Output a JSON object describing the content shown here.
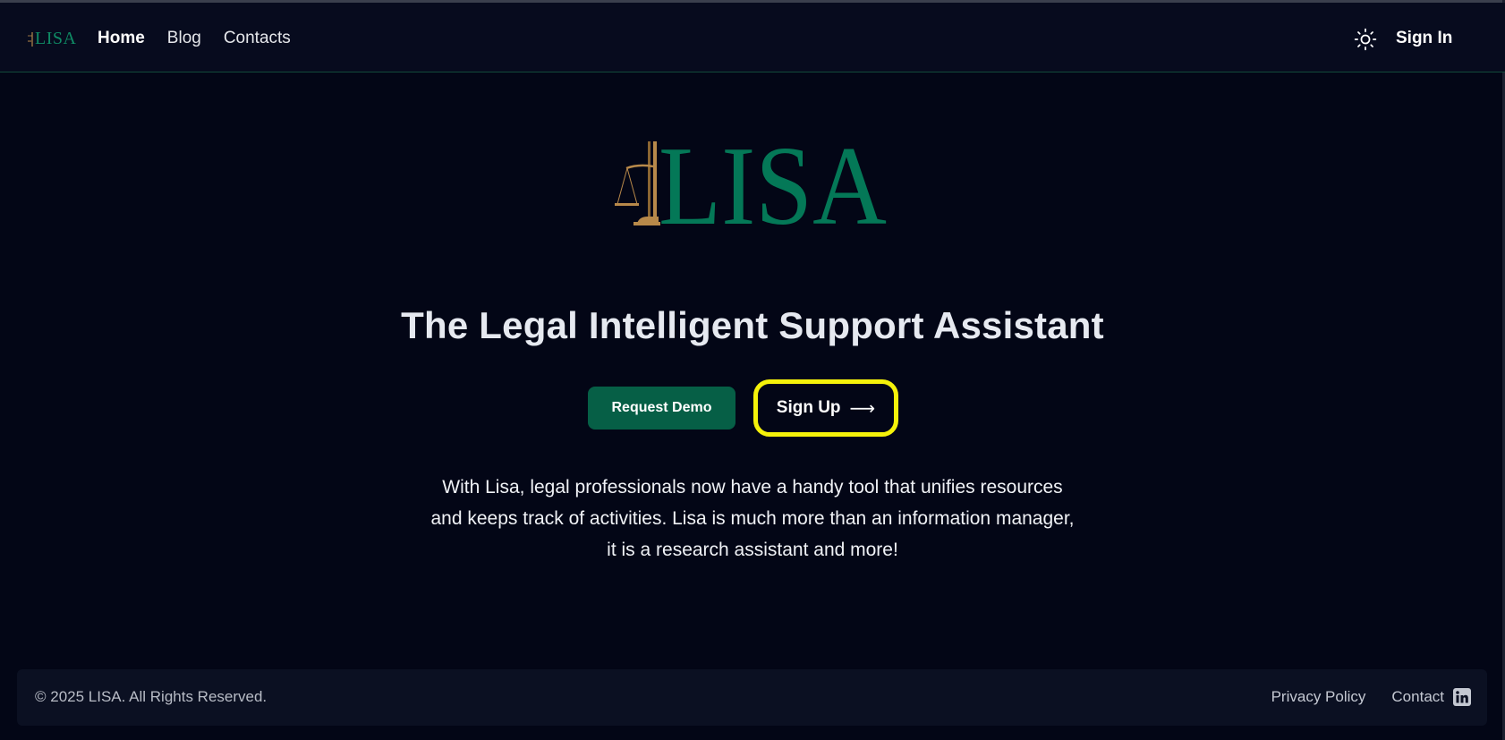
{
  "header": {
    "brand_text": "LISA",
    "nav": [
      {
        "label": "Home",
        "active": true
      },
      {
        "label": "Blog",
        "active": false
      },
      {
        "label": "Contacts",
        "active": false
      }
    ],
    "theme_icon": "sun-icon",
    "signin_label": "Sign In"
  },
  "hero": {
    "logo_text": "LISA",
    "title": "The Legal Intelligent Support Assistant",
    "request_demo_label": "Request Demo",
    "signup_label": "Sign Up",
    "signup_arrow": "⟶",
    "description": "With Lisa, legal professionals now have a handy tool that unifies resources and keeps track of activities. Lisa is much more than an information manager, it is a research assistant and more!"
  },
  "footer": {
    "copyright": "© 2025 LISA. All Rights Reserved.",
    "links": [
      "Privacy Policy",
      "Contact"
    ],
    "social_icon": "linkedin-icon"
  },
  "colors": {
    "background": "#030616",
    "header_bg": "#070b1e",
    "brand_green": "#0f8a64",
    "scale_gold": "#b8894a",
    "demo_button": "#065f46",
    "highlight_ring": "#f5f20a"
  }
}
